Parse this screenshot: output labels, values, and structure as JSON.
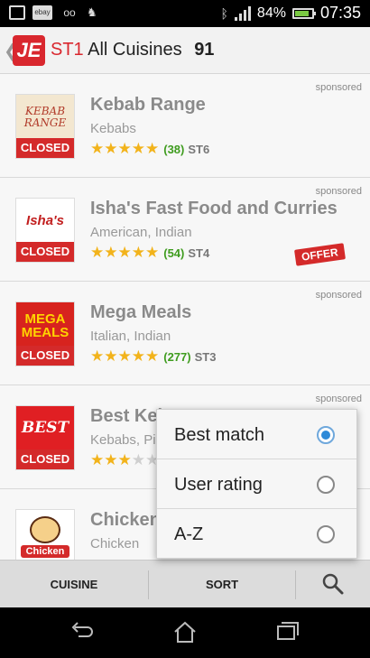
{
  "statusbar": {
    "left_icons": [
      "image-icon",
      "ebay-icon",
      "voicemail-icon",
      "animal-icon"
    ],
    "ebay_text": "ebay",
    "voicemail_text": "oo",
    "battery_percent": "84%",
    "battery_level": 0.84,
    "time": "07:35"
  },
  "actionbar": {
    "logo_text": "JE",
    "postcode": "ST1",
    "title": "All Cuisines",
    "count": "91"
  },
  "restaurants": [
    {
      "name": "Kebab Range",
      "cuisine": "Kebabs",
      "rating": 4.5,
      "reviews": "(38)",
      "postcode": "ST6",
      "sponsored": "sponsored",
      "closed": "CLOSED",
      "logo_text": "KEBAB RANGE",
      "offer": ""
    },
    {
      "name": "Isha's Fast Food and Curries",
      "cuisine": "American, Indian",
      "rating": 4.5,
      "reviews": "(54)",
      "postcode": "ST4",
      "sponsored": "sponsored",
      "closed": "CLOSED",
      "logo_text": "Isha's",
      "offer": "OFFER"
    },
    {
      "name": "Mega Meals",
      "cuisine": "Italian, Indian",
      "rating": 4.5,
      "reviews": "(277)",
      "postcode": "ST3",
      "sponsored": "sponsored",
      "closed": "CLOSED",
      "logo_text": "MEGA MEALS",
      "offer": ""
    },
    {
      "name": "Best Kel",
      "cuisine": "Kebabs, Pi",
      "rating": 3,
      "reviews": "",
      "postcode": "",
      "sponsored": "sponsored",
      "closed": "CLOSED",
      "logo_text": "BEST",
      "offer": ""
    },
    {
      "name": "Chicken",
      "cuisine": "Chicken",
      "rating": 0,
      "reviews": "",
      "postcode": "",
      "sponsored": "",
      "closed": "",
      "logo_text": "Chicken",
      "offer": ""
    }
  ],
  "sort_popup": {
    "options": [
      {
        "label": "Best match",
        "selected": true
      },
      {
        "label": "User rating",
        "selected": false
      },
      {
        "label": "A-Z",
        "selected": false
      }
    ]
  },
  "bottombar": {
    "cuisine_label": "CUISINE",
    "sort_label": "SORT",
    "search_icon": "search-icon"
  },
  "navbar": {
    "icons": [
      "back-icon",
      "home-icon",
      "recent-apps-icon"
    ]
  },
  "colors": {
    "brand_red": "#d9272e",
    "rating_green": "#3f9c1f",
    "star_gold": "#f2b31b",
    "radio_blue": "#2e8ad8"
  }
}
